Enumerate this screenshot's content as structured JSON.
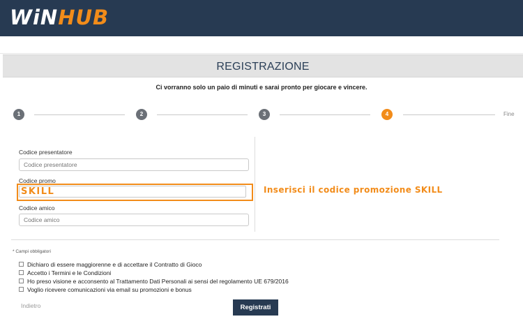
{
  "brand": {
    "logo_white": "WiN",
    "logo_orange": "HUB"
  },
  "header": {
    "title": "REGISTRAZIONE"
  },
  "subtitle": "Ci vorranno solo un paio di minuti e sarai pronto per giocare e vincere.",
  "stepper": {
    "steps": [
      "1",
      "2",
      "3",
      "4"
    ],
    "active_step": "4",
    "end_label": "Fine"
  },
  "form": {
    "presenter": {
      "label": "Codice presentatore",
      "placeholder": "Codice presentatore"
    },
    "promo": {
      "label": "Codice promo",
      "value": "SKILL"
    },
    "friend": {
      "label": "Codice amico",
      "placeholder": "Codice amico"
    }
  },
  "promo_hint": "Inserisci il codice promozione SKILL",
  "required_note": "* Campi obbligatori",
  "checkboxes": [
    {
      "label": "Dichiaro di essere maggiorenne e di accettare il Contratto di Gioco",
      "checked": false
    },
    {
      "label": "Accetto i Termini e le Condizioni",
      "checked": false
    },
    {
      "label": "Ho preso visione e acconsento al Trattamento Dati Personali ai sensi del regolamento UE 679/2016",
      "checked": false
    },
    {
      "label": "Voglio ricevere comunicazioni via email su promozioni e bonus",
      "checked": false
    }
  ],
  "actions": {
    "back_label": "Indietro",
    "submit_label": "Registrati"
  },
  "colors": {
    "navy": "#273a52",
    "accent": "#f28c1a"
  }
}
